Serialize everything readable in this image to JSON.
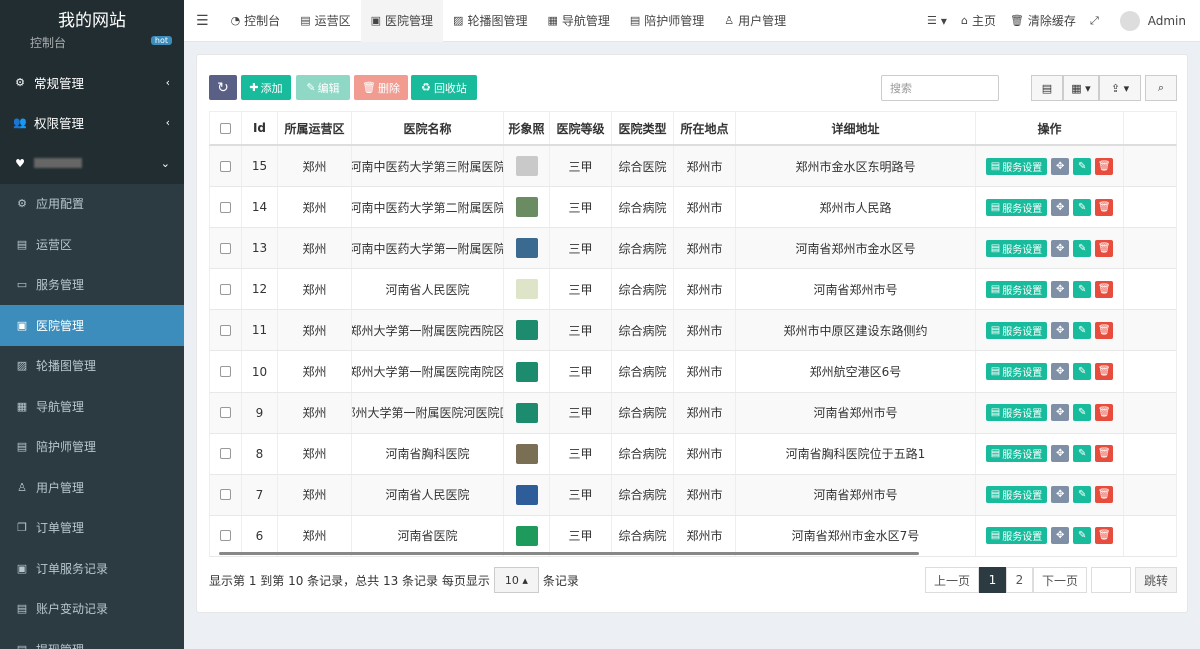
{
  "brand": "我的网站",
  "sidebar": {
    "partial_top": {
      "label": "控制台",
      "badge": "hot"
    },
    "items": [
      {
        "label": "常规管理",
        "icon": "cogs-icon",
        "glyph": "⚙",
        "type": "top",
        "chev": "‹"
      },
      {
        "label": "权限管理",
        "icon": "users-icon",
        "glyph": "👥",
        "type": "top",
        "chev": "‹"
      },
      {
        "label": "",
        "icon": "heartbeat-icon",
        "glyph": "♥",
        "type": "top",
        "chev": "⌄",
        "blurred": true
      },
      {
        "label": "应用配置",
        "icon": "gear-icon",
        "glyph": "⚙",
        "type": "sub"
      },
      {
        "label": "运营区",
        "icon": "map-icon",
        "glyph": "▤",
        "type": "sub"
      },
      {
        "label": "服务管理",
        "icon": "list-icon",
        "glyph": "▭",
        "type": "sub"
      },
      {
        "label": "医院管理",
        "icon": "hospital-icon",
        "glyph": "▣",
        "type": "sub",
        "active": true
      },
      {
        "label": "轮播图管理",
        "icon": "image-icon",
        "glyph": "▨",
        "type": "sub"
      },
      {
        "label": "导航管理",
        "icon": "table-icon",
        "glyph": "▦",
        "type": "sub"
      },
      {
        "label": "陪护师管理",
        "icon": "id-card-icon",
        "glyph": "▤",
        "type": "sub"
      },
      {
        "label": "用户管理",
        "icon": "user-icon",
        "glyph": "♙",
        "type": "sub"
      },
      {
        "label": "订单管理",
        "icon": "clone-icon",
        "glyph": "❐",
        "type": "sub"
      },
      {
        "label": "订单服务记录",
        "icon": "save-icon",
        "glyph": "▣",
        "type": "sub"
      },
      {
        "label": "账户变动记录",
        "icon": "list-alt-icon",
        "glyph": "▤",
        "type": "sub"
      },
      {
        "label": "提现管理",
        "icon": "money-icon",
        "glyph": "▤",
        "type": "sub"
      }
    ]
  },
  "topbar": {
    "tabs": [
      {
        "label": "控制台",
        "icon": "dashboard-icon",
        "glyph": "◔"
      },
      {
        "label": "运营区",
        "icon": "map-icon",
        "glyph": "▤"
      },
      {
        "label": "医院管理",
        "icon": "hospital-icon",
        "glyph": "▣",
        "active": true
      },
      {
        "label": "轮播图管理",
        "icon": "image-icon",
        "glyph": "▨"
      },
      {
        "label": "导航管理",
        "icon": "table-icon",
        "glyph": "▦"
      },
      {
        "label": "陪护师管理",
        "icon": "id-card-icon",
        "glyph": "▤"
      },
      {
        "label": "用户管理",
        "icon": "user-icon",
        "glyph": "♙"
      }
    ],
    "right": [
      {
        "label": "▾",
        "icon": "list-icon",
        "glyph": "☰"
      },
      {
        "label": "主页",
        "icon": "home-icon",
        "glyph": "⌂"
      },
      {
        "label": "清除缓存",
        "icon": "trash-icon",
        "glyph": "🗑"
      },
      {
        "label": "",
        "icon": "fullscreen-icon",
        "glyph": "⤢"
      }
    ],
    "user": "Admin"
  },
  "toolbar": {
    "refresh": "↻",
    "add": "添加",
    "edit": "编辑",
    "delete": "删除",
    "recycle": "回收站",
    "search_placeholder": "搜索"
  },
  "colors": {
    "primary": "#18bc9c",
    "dark": "#2c3b41",
    "danger": "#e74c3c",
    "purple": "#5a5f86",
    "gray": "#95a5a6"
  },
  "table": {
    "headers": [
      "",
      "Id",
      "所属运营区",
      "医院名称",
      "形象照",
      "医院等级",
      "医院类型",
      "所在地点",
      "详细地址",
      "操作"
    ],
    "rows": [
      {
        "id": "15",
        "area": "郑州",
        "name": "河南中医药大学第三附属医院",
        "thumb": "#c9c9c9",
        "level": "三甲",
        "type": "综合医院",
        "loc": "郑州市",
        "addr": "郑州市金水区东明路号"
      },
      {
        "id": "14",
        "area": "郑州",
        "name": "河南中医药大学第二附属医院",
        "thumb": "#6b8c62",
        "level": "三甲",
        "type": "综合病院",
        "loc": "郑州市",
        "addr": "郑州市人民路"
      },
      {
        "id": "13",
        "area": "郑州",
        "name": "河南中医药大学第一附属医院",
        "thumb": "#3a6a8f",
        "level": "三甲",
        "type": "综合病院",
        "loc": "郑州市",
        "addr": "河南省郑州市金水区号"
      },
      {
        "id": "12",
        "area": "郑州",
        "name": "河南省人民医院",
        "thumb": "#dde4c8",
        "level": "三甲",
        "type": "综合病院",
        "loc": "郑州市",
        "addr": "河南省郑州市号"
      },
      {
        "id": "11",
        "area": "郑州",
        "name": "郑州大学第一附属医院西院区",
        "thumb": "#1d8c6e",
        "level": "三甲",
        "type": "综合病院",
        "loc": "郑州市",
        "addr": "郑州市中原区建设东路侧约"
      },
      {
        "id": "10",
        "area": "郑州",
        "name": "郑州大学第一附属医院南院区",
        "thumb": "#1d8c6e",
        "level": "三甲",
        "type": "综合病院",
        "loc": "郑州市",
        "addr": "郑州航空港区6号"
      },
      {
        "id": "9",
        "area": "郑州",
        "name": "郑州大学第一附属医院河医院区",
        "thumb": "#1d8c6e",
        "level": "三甲",
        "type": "综合病院",
        "loc": "郑州市",
        "addr": "河南省郑州市号"
      },
      {
        "id": "8",
        "area": "郑州",
        "name": "河南省胸科医院",
        "thumb": "#7a6f55",
        "level": "三甲",
        "type": "综合病院",
        "loc": "郑州市",
        "addr": "河南省胸科医院位于五路1"
      },
      {
        "id": "7",
        "area": "郑州",
        "name": "河南省人民医院",
        "thumb": "#2f5d9a",
        "level": "三甲",
        "type": "综合病院",
        "loc": "郑州市",
        "addr": "河南省郑州市号"
      },
      {
        "id": "6",
        "area": "郑州",
        "name": "河南省医院",
        "thumb": "#1e9a5c",
        "level": "三甲",
        "type": "综合病院",
        "loc": "郑州市",
        "addr": "河南省郑州市金水区7号"
      }
    ],
    "service_btn": "服务设置"
  },
  "footer": {
    "summary": "显示第 1 到第 10 条记录，总共 13 条记录 每页显示",
    "page_size": "10",
    "suffix": "条记录"
  },
  "pagination": {
    "prev": "上一页",
    "pages": [
      "1",
      "2"
    ],
    "next": "下一页",
    "jump": "跳转"
  }
}
